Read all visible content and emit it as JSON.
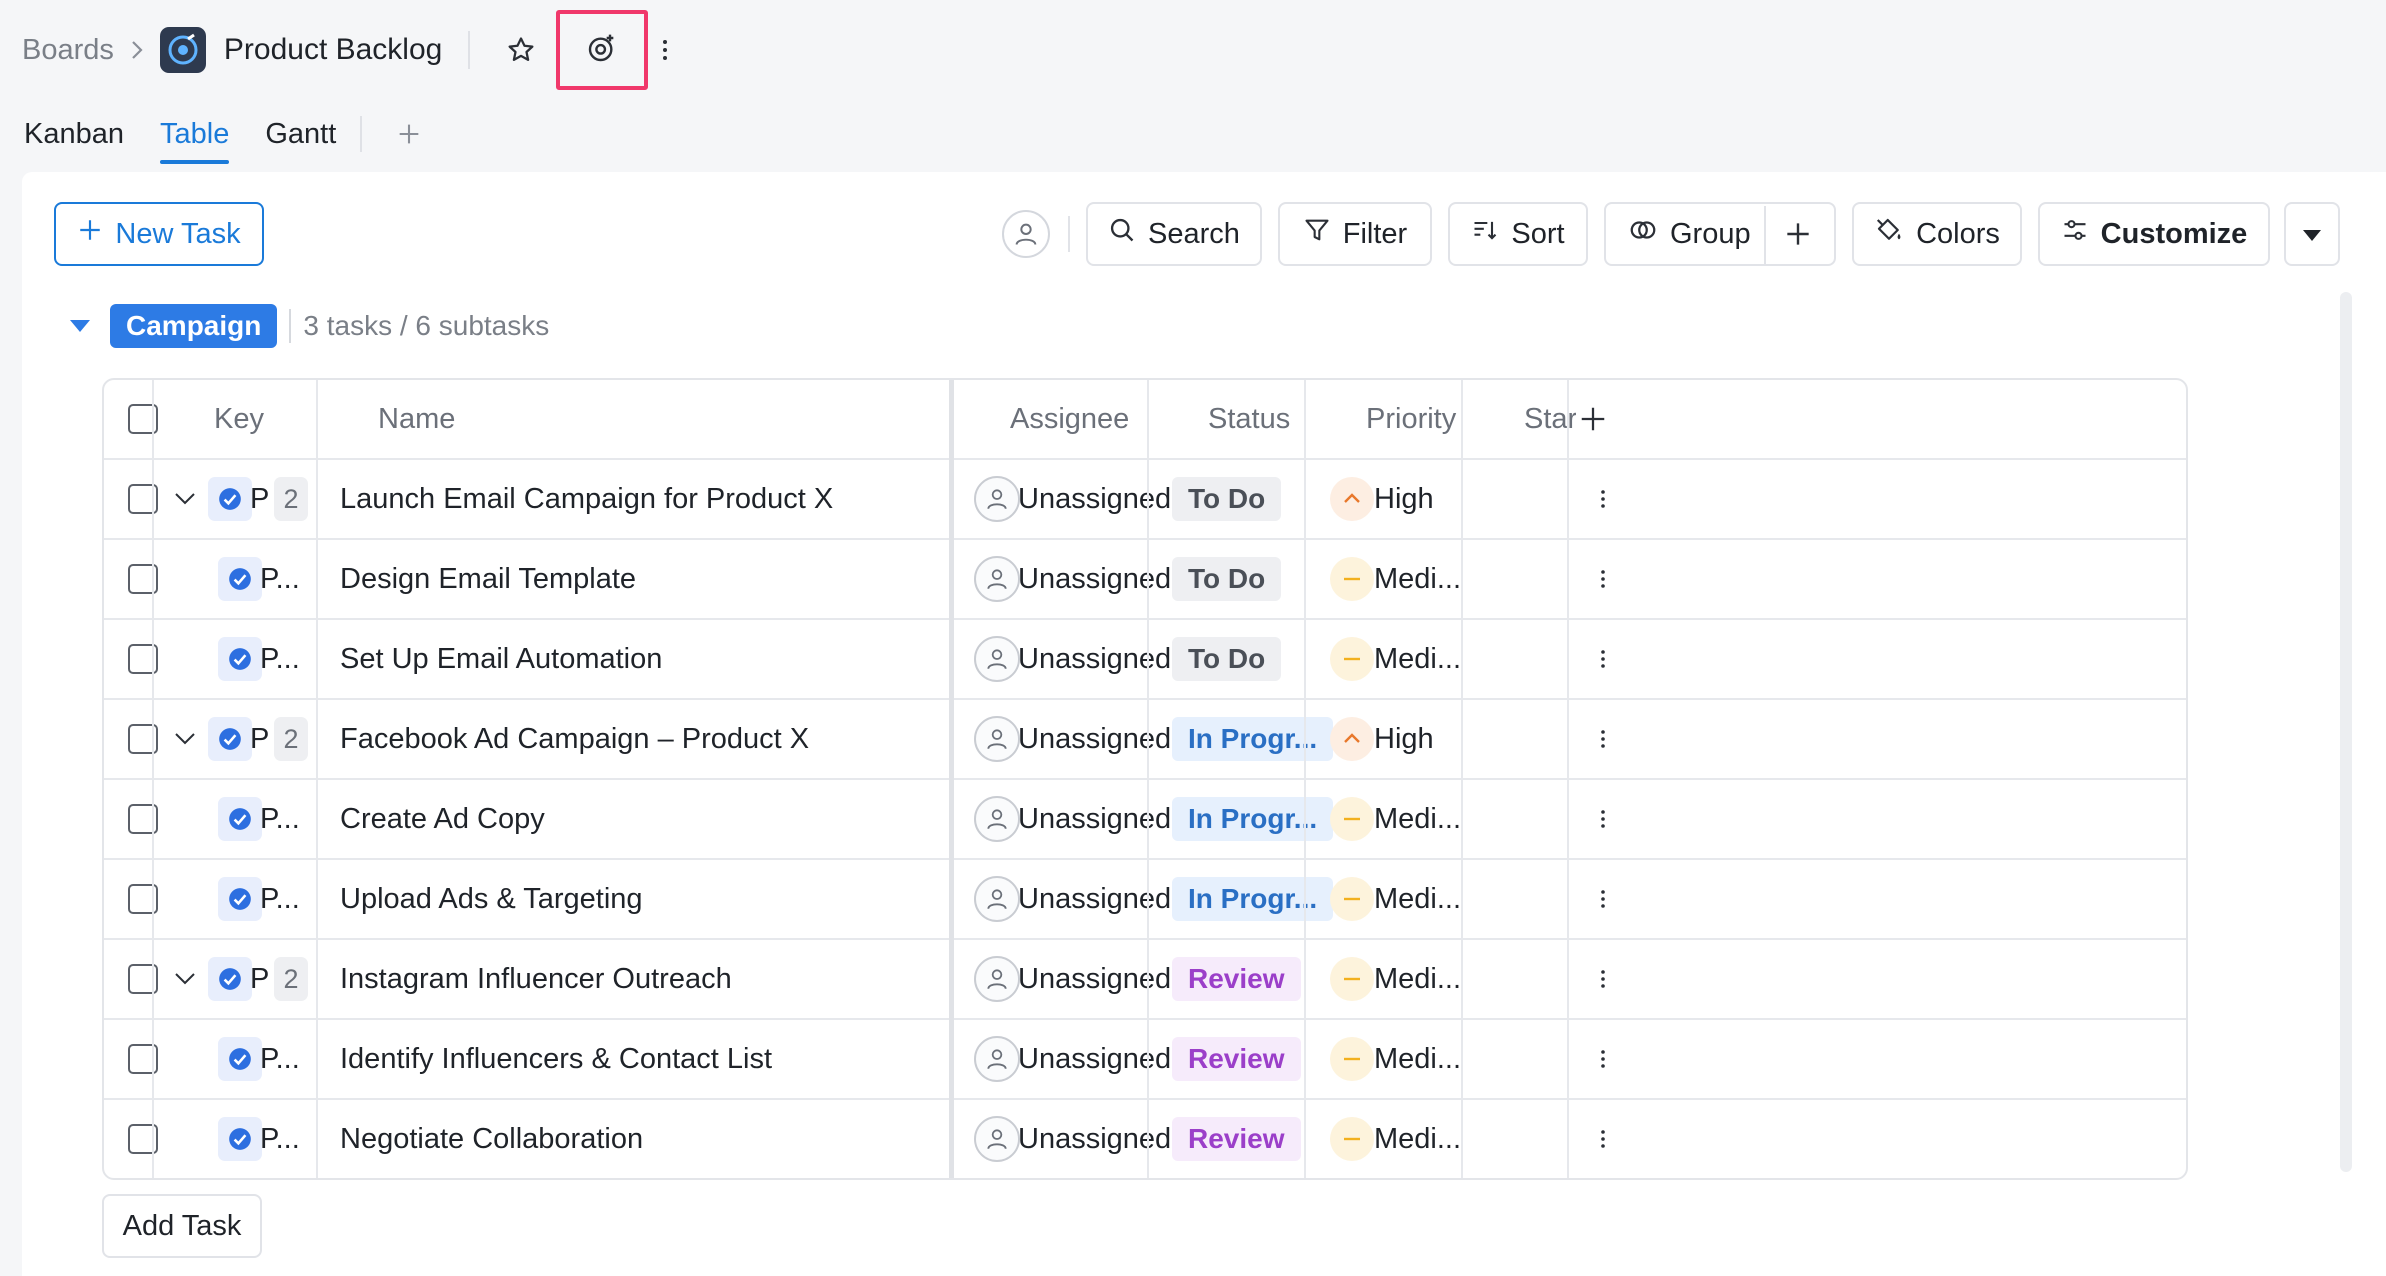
{
  "breadcrumb": {
    "root": "Boards",
    "board_title": "Product Backlog"
  },
  "tabs": [
    {
      "label": "Kanban"
    },
    {
      "label": "Table"
    },
    {
      "label": "Gantt"
    }
  ],
  "toolbar": {
    "new_task": "New Task",
    "search": "Search",
    "filter": "Filter",
    "sort": "Sort",
    "group": "Group",
    "colors": "Colors",
    "customize": "Customize"
  },
  "group": {
    "name": "Campaign",
    "summary": "3 tasks / 6 subtasks"
  },
  "table": {
    "columns": {
      "key": "Key",
      "name": "Name",
      "assignee": "Assignee",
      "status": "Status",
      "priority": "Priority",
      "start": "Star"
    },
    "rows": [
      {
        "parent": true,
        "key": "P",
        "subtasks": "2",
        "name": "Launch Email Campaign for Product X",
        "assignee": "Unassigned",
        "status": "To Do",
        "priority": "High"
      },
      {
        "parent": false,
        "key": "P...",
        "name": "Design Email Template",
        "assignee": "Unassigned",
        "status": "To Do",
        "priority": "Medi..."
      },
      {
        "parent": false,
        "key": "P...",
        "name": "Set Up Email Automation",
        "assignee": "Unassigned",
        "status": "To Do",
        "priority": "Medi..."
      },
      {
        "parent": true,
        "key": "P",
        "subtasks": "2",
        "name": "Facebook Ad Campaign – Product X",
        "assignee": "Unassigned",
        "status": "In Progr...",
        "priority": "High"
      },
      {
        "parent": false,
        "key": "P...",
        "name": "Create Ad Copy",
        "assignee": "Unassigned",
        "status": "In Progr...",
        "priority": "Medi..."
      },
      {
        "parent": false,
        "key": "P...",
        "name": "Upload Ads & Targeting",
        "assignee": "Unassigned",
        "status": "In Progr...",
        "priority": "Medi..."
      },
      {
        "parent": true,
        "key": "P",
        "subtasks": "2",
        "name": "Instagram Influencer Outreach",
        "assignee": "Unassigned",
        "status": "Review",
        "priority": "Medi..."
      },
      {
        "parent": false,
        "key": "P...",
        "name": "Identify Influencers & Contact List",
        "assignee": "Unassigned",
        "status": "Review",
        "priority": "Medi..."
      },
      {
        "parent": false,
        "key": "P...",
        "name": "Negotiate Collaboration",
        "assignee": "Unassigned",
        "status": "Review",
        "priority": "Medi..."
      }
    ]
  },
  "add_task": "Add Task",
  "colors": {
    "accent": "#1a7ad9",
    "group_badge": "#2d7be5",
    "highlight_box": "#f0386b",
    "status_todo_bg": "#eeeff2",
    "status_todo_fg": "#4a4f57",
    "status_inprogress_bg": "#e6f0fd",
    "status_inprogress_fg": "#2a6fc4",
    "status_review_bg": "#f6ebfb",
    "status_review_fg": "#9b3fc9",
    "priority_high": "#e8782b",
    "priority_medium": "#f2b01e"
  },
  "icons": {
    "chevron-right": "breadcrumb separator",
    "star": "favorite",
    "watch": "watch board",
    "kebab": "more options",
    "plus": "add",
    "search": "search",
    "filter": "funnel",
    "sort": "sort",
    "group": "group",
    "colors": "paint bucket",
    "customize": "sliders",
    "caret-down": "dropdown"
  }
}
